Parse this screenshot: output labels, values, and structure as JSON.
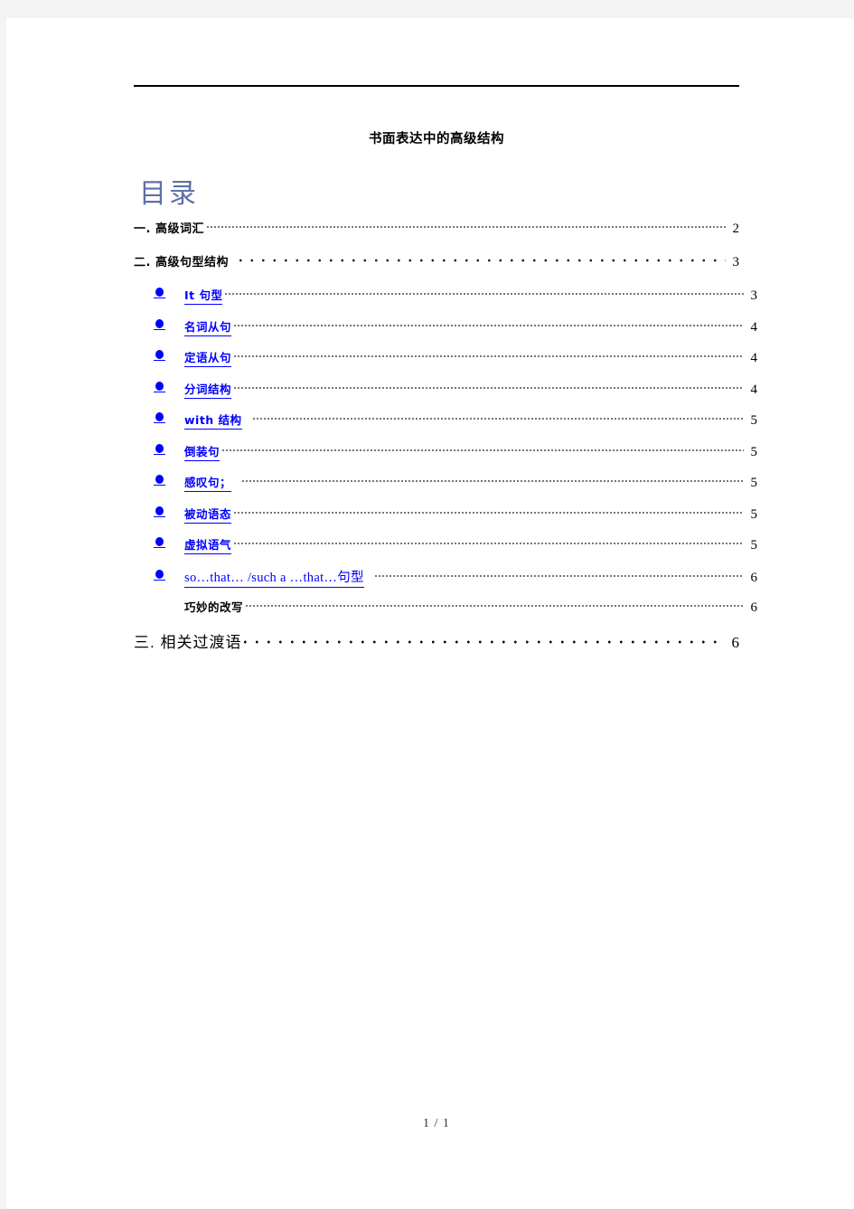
{
  "document": {
    "title": "书面表达中的高级结构",
    "toc_heading": "目录",
    "footer": "1 / 1"
  },
  "colors": {
    "link": "#0000FF",
    "toc_heading": "#5F6FA6",
    "text": "#000000",
    "page_background": "#FFFFFF",
    "canvas_background": "#F4F4F4"
  },
  "toc": {
    "entries": [
      {
        "label": "一. 高级词汇",
        "page": "2",
        "level": 1,
        "style": "bold",
        "leader": "fine"
      },
      {
        "label": "二. 高级句型结构",
        "page": "3",
        "level": 1,
        "style": "bold",
        "leader": "wide"
      },
      {
        "label": "It 句型",
        "page": "3",
        "level": 2,
        "style": "link",
        "leader": "fine"
      },
      {
        "label": "名词从句",
        "page": "4",
        "level": 2,
        "style": "link",
        "leader": "fine"
      },
      {
        "label": "定语从句",
        "page": "4",
        "level": 2,
        "style": "link",
        "leader": "fine"
      },
      {
        "label": "分词结构",
        "page": "4",
        "level": 2,
        "style": "link",
        "leader": "fine"
      },
      {
        "label": "with 结构",
        "page": "5",
        "level": 2,
        "style": "link",
        "leader": "fine"
      },
      {
        "label": "倒装句",
        "page": "5",
        "level": 2,
        "style": "link",
        "leader": "fine"
      },
      {
        "label": "感叹句；",
        "page": "5",
        "level": 2,
        "style": "link",
        "leader": "fine"
      },
      {
        "label": "被动语态",
        "page": "5",
        "level": 2,
        "style": "link",
        "leader": "fine"
      },
      {
        "label": "虚拟语气",
        "page": "5",
        "level": 2,
        "style": "link",
        "leader": "fine"
      },
      {
        "label": "so…that… /such a …that…句型",
        "page": "6",
        "level": 2,
        "style": "link-serif",
        "leader": "fine"
      },
      {
        "label": "巧妙的改写",
        "page": "6",
        "level": 2,
        "style": "plain",
        "leader": "fine"
      },
      {
        "label": "三.   相关过渡语",
        "page": "6",
        "level": 1,
        "style": "thin",
        "leader": "wide2"
      }
    ]
  }
}
